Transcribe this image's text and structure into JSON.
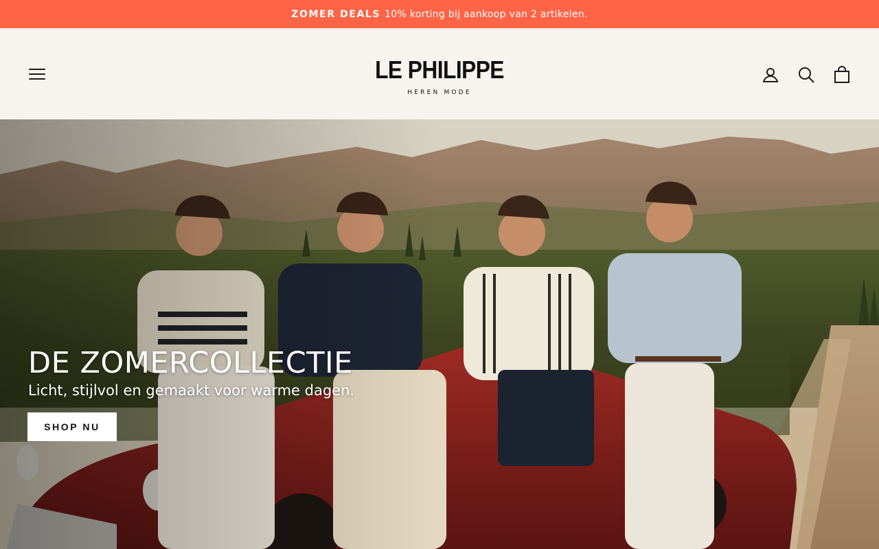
{
  "announcement": {
    "highlight": "ZOMER DEALS",
    "text": "10% korting bij aankoop van 2 artikelen."
  },
  "header": {
    "logo_main": "LE PHILIPPE",
    "logo_sub": "HEREN MODE",
    "icons": [
      "menu-icon",
      "account-icon",
      "search-icon",
      "cart-icon"
    ]
  },
  "hero": {
    "title": "DE ZOMERCOLLECTIE",
    "subtitle": "Licht, stijlvol en gemaakt voor warme dagen.",
    "cta_label": "SHOP NU"
  },
  "colors": {
    "announcement_bg": "#ff6446",
    "header_bg": "#f7f3ee",
    "text_dark": "#111111",
    "button_bg": "#ffffff"
  }
}
